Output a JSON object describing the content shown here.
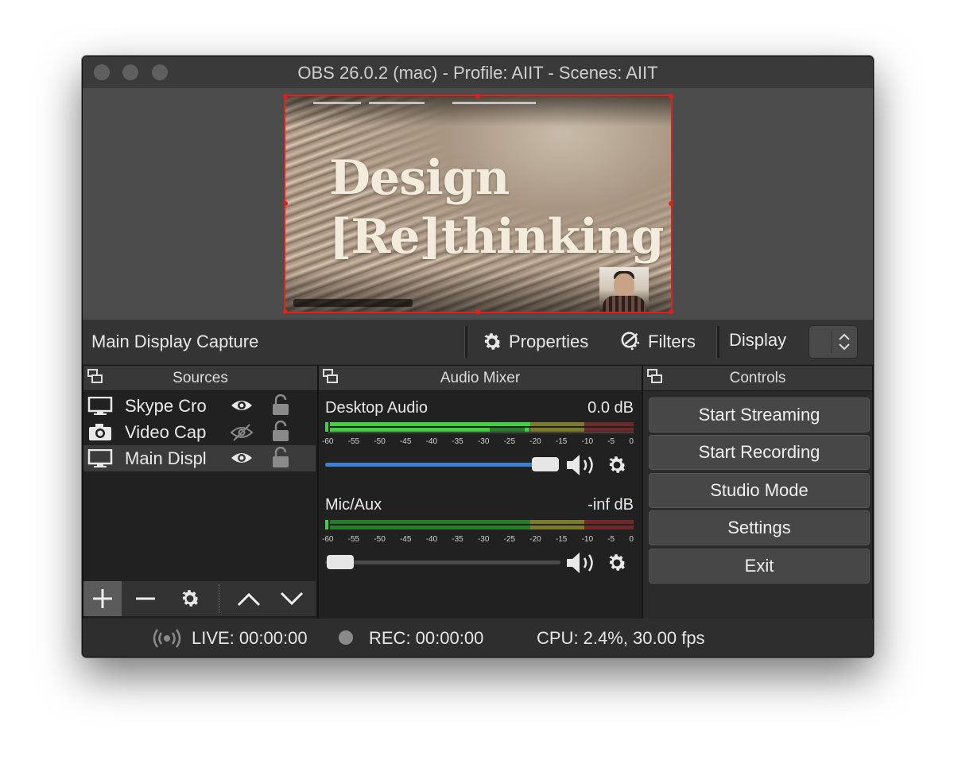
{
  "window": {
    "title": "OBS 26.0.2 (mac) - Profile: AIIT - Scenes: AIIT"
  },
  "preview": {
    "slide_title_line1": "Design",
    "slide_title_line2": "[Re]thinking"
  },
  "source_toolbar": {
    "current_source": "Main Display Capture",
    "properties_label": "Properties",
    "filters_label": "Filters",
    "display_label": "Display"
  },
  "sources": {
    "title": "Sources",
    "items": [
      {
        "label": "Skype Cro",
        "icon": "monitor-icon",
        "visible": true,
        "locked": false,
        "selected": false
      },
      {
        "label": "Video Cap",
        "icon": "camera-icon",
        "visible": false,
        "locked": false,
        "selected": false
      },
      {
        "label": "Main Displ",
        "icon": "monitor-icon",
        "visible": true,
        "locked": false,
        "selected": true
      }
    ]
  },
  "audio_mixer": {
    "title": "Audio Mixer",
    "ticks": [
      "-60",
      "-55",
      "-50",
      "-45",
      "-40",
      "-35",
      "-30",
      "-25",
      "-20",
      "-15",
      "-10",
      "-5",
      "0"
    ],
    "channels": [
      {
        "name": "Desktop Audio",
        "level": "0.0 dB",
        "volume_fraction": 1.0
      },
      {
        "name": "Mic/Aux",
        "level": "-inf dB",
        "volume_fraction": 0.0
      }
    ]
  },
  "controls": {
    "title": "Controls",
    "buttons": [
      "Start Streaming",
      "Start Recording",
      "Studio Mode",
      "Settings",
      "Exit"
    ]
  },
  "status": {
    "live": "LIVE: 00:00:00",
    "rec": "REC: 00:00:00",
    "cpu": "CPU: 2.4%, 30.00 fps"
  },
  "colors": {
    "accent_blue": "#3b82d6",
    "selection_red": "#e02020",
    "meter_green": "#3fd13f",
    "meter_yellow": "#b5a93a",
    "meter_red": "#b83434"
  }
}
